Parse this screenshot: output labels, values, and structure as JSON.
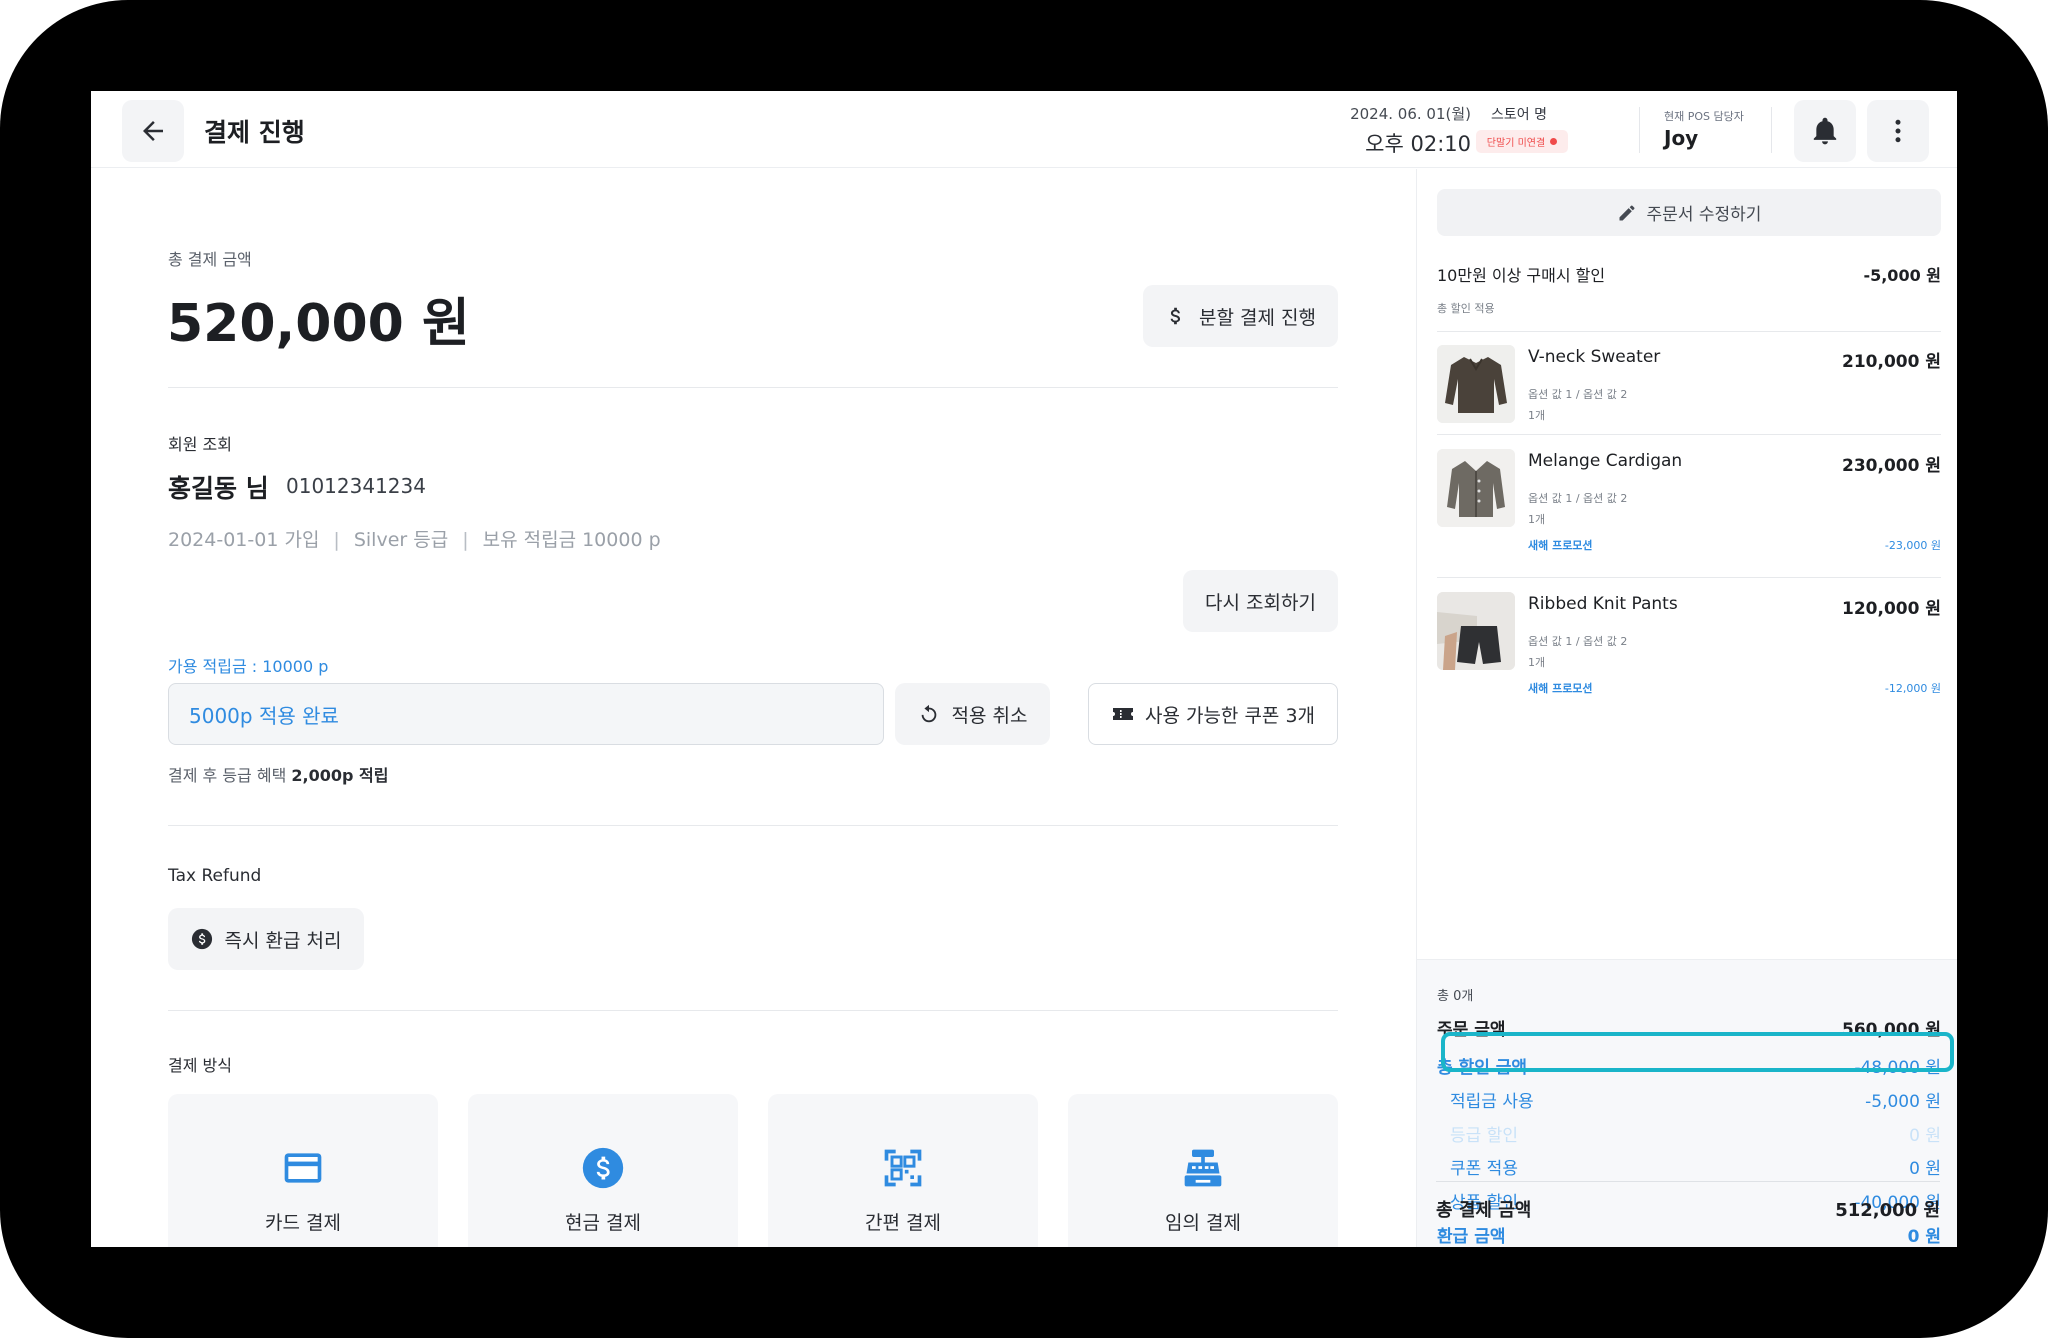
{
  "header": {
    "title": "결제 진행",
    "date": "2024. 06. 01(월)",
    "time": "오후 02:10",
    "store_label": "스토어 명",
    "store_status": "단말기 미연결",
    "pos_label": "현재 POS 담당자",
    "pos_name": "Joy"
  },
  "payment": {
    "total_label": "총 결제 금액",
    "total_amount": "520,000 원",
    "split_button": "분할 결제 진행"
  },
  "member": {
    "section_label": "회원 조회",
    "name": "홍길동 님",
    "phone": "01012341234",
    "joined": "2024-01-01 가입",
    "grade": "Silver 등급",
    "points_held": "보유 적립금 10000 p",
    "separator": "|",
    "requery_button": "다시 조회하기",
    "available_points": "가용 적립금 : 10000 p",
    "points_input_value": "5000p 적용 완료",
    "cancel_apply_button": "적용 취소",
    "coupon_button": "사용 가능한 쿠폰 3개",
    "benefit_prefix": "결제 후 등급 혜택 ",
    "benefit_value": "2,000p 적립"
  },
  "tax": {
    "label": "Tax Refund",
    "button": "즉시 환급 처리"
  },
  "methods": {
    "label": "결제 방식",
    "items": [
      {
        "label": "카드 결제",
        "icon": "credit-card-icon"
      },
      {
        "label": "현금 결제",
        "icon": "dollar-coin-icon"
      },
      {
        "label": "간편 결제",
        "icon": "qr-code-icon"
      },
      {
        "label": "임의 결제",
        "icon": "cash-register-icon"
      }
    ]
  },
  "order": {
    "edit_button": "주문서 수정하기",
    "discount_name": "10만원 이상 구매시 할인",
    "discount_value": "-5,000 원",
    "discount_sub": "총 할인 적용",
    "items": [
      {
        "name": "V-neck Sweater",
        "price": "210,000 원",
        "options": "옵션 값 1 / 옵션 값 2",
        "qty": "1개",
        "promo": "",
        "promo_value": ""
      },
      {
        "name": "Melange Cardigan",
        "price": "230,000 원",
        "options": "옵션 값 1 / 옵션 값 2",
        "qty": "1개",
        "promo": "새해 프로모션",
        "promo_value": "-23,000 원"
      },
      {
        "name": "Ribbed Knit Pants",
        "price": "120,000 원",
        "options": "옵션 값 1 / 옵션 값 2",
        "qty": "1개",
        "promo": "새해 프로모션",
        "promo_value": "-12,000 원"
      }
    ]
  },
  "summary": {
    "count": "총 0개",
    "order_amount_label": "주문 금액",
    "order_amount": "560,000 원",
    "total_discount_label": "총 할인 금액",
    "total_discount": "-48,000 원",
    "points_used_label": "적립금 사용",
    "points_used": "-5,000 원",
    "grade_discount_label": "등급 할인",
    "grade_discount": "0 원",
    "coupon_label": "쿠폰 적용",
    "coupon": "0 원",
    "product_discount_label": "상품 할인",
    "product_discount": "-40,000 원",
    "refund_label": "환급 금액",
    "refund": "0 원",
    "final_label": "총 결제 금액",
    "final_amount": "512,000 원"
  },
  "colors": {
    "accent_blue": "#2f8be0",
    "highlight": "#1ab5c9",
    "status_red": "#f04b4b"
  }
}
